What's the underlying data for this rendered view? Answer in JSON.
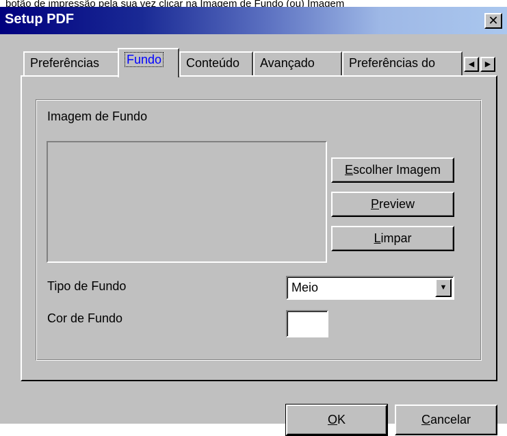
{
  "window": {
    "title": "Setup PDF",
    "close_label": "✕",
    "background_text": "botão de impressão pela sua vez clicar na Imagem de Fundo (ou) Imagem"
  },
  "tabs": [
    {
      "label": "Preferências",
      "active": false
    },
    {
      "label": "Fundo",
      "active": true
    },
    {
      "label": "Conteúdo",
      "active": false
    },
    {
      "label": "Avançado",
      "active": false
    },
    {
      "label": "Preferências do",
      "active": false
    }
  ],
  "tab_scroll": {
    "left": "◀",
    "right": "▶"
  },
  "fundo": {
    "image_section_label": "Imagem de Fundo",
    "choose_image_button": {
      "mnemonic": "E",
      "rest": "scolher Imagem"
    },
    "preview_button": {
      "mnemonic": "P",
      "rest": "review"
    },
    "clear_button": {
      "mnemonic": "L",
      "rest": "impar"
    },
    "type_label": "Tipo de Fundo",
    "type_value": "Meio",
    "type_arrow": "▼",
    "color_label": "Cor de Fundo",
    "color_value": "#ffffff"
  },
  "footer": {
    "ok_button": {
      "mnemonic": "O",
      "rest": "K"
    },
    "cancel_button": {
      "mnemonic": "C",
      "rest": "ancelar"
    }
  }
}
